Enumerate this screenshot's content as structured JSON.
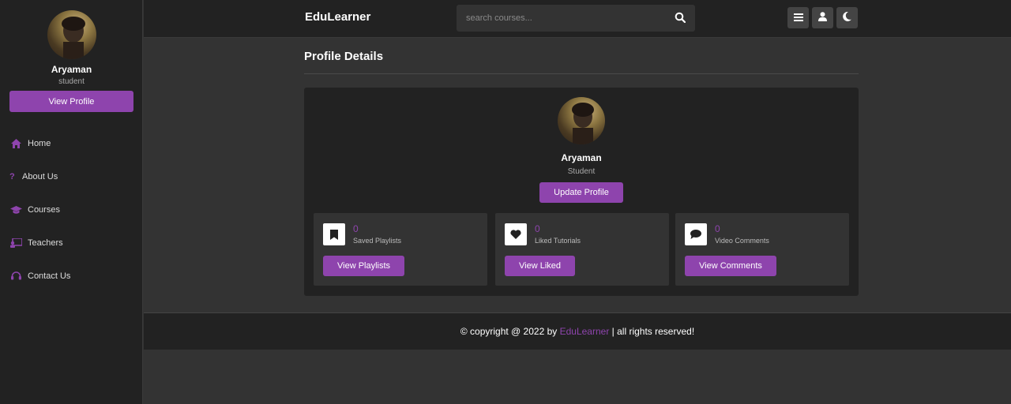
{
  "sidebar": {
    "user_name": "Aryaman",
    "user_role": "student",
    "view_profile_label": "View Profile",
    "items": [
      {
        "label": "Home",
        "icon": "home-icon"
      },
      {
        "label": "About Us",
        "icon": "question-icon"
      },
      {
        "label": "Courses",
        "icon": "graduation-cap-icon"
      },
      {
        "label": "Teachers",
        "icon": "chalkboard-teacher-icon"
      },
      {
        "label": "Contact Us",
        "icon": "headset-icon"
      }
    ]
  },
  "header": {
    "logo": "EduLearner",
    "search_placeholder": "search courses...",
    "icons": [
      "menu-icon",
      "user-icon",
      "moon-icon"
    ]
  },
  "main": {
    "title": "Profile Details",
    "profile": {
      "name": "Aryaman",
      "role": "Student",
      "update_label": "Update Profile"
    },
    "stats": [
      {
        "count": "0",
        "label": "Saved Playlists",
        "button": "View Playlists",
        "icon": "bookmark-icon"
      },
      {
        "count": "0",
        "label": "Liked Tutorials",
        "button": "View Liked",
        "icon": "heart-icon"
      },
      {
        "count": "0",
        "label": "Video Comments",
        "button": "View Comments",
        "icon": "comment-icon"
      }
    ]
  },
  "footer": {
    "prefix": "© copyright @ 2022 by ",
    "brand": "EduLearner",
    "suffix": " | all rights reserved!"
  },
  "colors": {
    "accent": "#8e44ad",
    "panel": "#222222",
    "background": "#333333"
  }
}
